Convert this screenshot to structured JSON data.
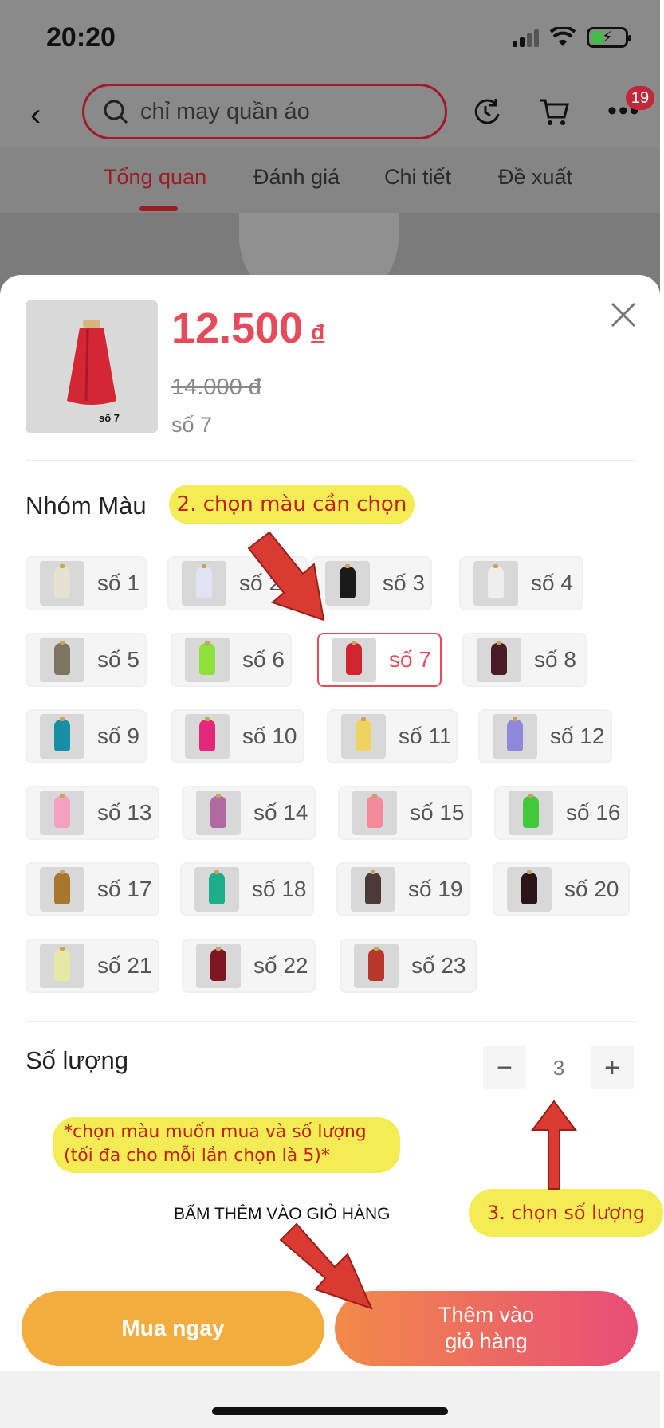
{
  "status_bar": {
    "time": "20:20"
  },
  "search": {
    "query": "chỉ may quần áo"
  },
  "cart_badge": "19",
  "tabs": [
    "Tổng quan",
    "Đánh giá",
    "Chi tiết",
    "Đề xuất"
  ],
  "product": {
    "thumb_caption": "số 7",
    "price": "12.500",
    "currency": "đ",
    "old_price": "14.000 đ",
    "selected_variant": "số 7"
  },
  "variant_group": {
    "title": "Nhóm Màu",
    "selected_index": 6,
    "options": [
      {
        "label": "số 1",
        "color": "#e6e2cf"
      },
      {
        "label": "số 2",
        "color": "#dfe3f2"
      },
      {
        "label": "số 3",
        "color": "#1a1a1a"
      },
      {
        "label": "số 4",
        "color": "#eeeeee"
      },
      {
        "label": "số 5",
        "color": "#7e7462"
      },
      {
        "label": "số 6",
        "color": "#8fe03a"
      },
      {
        "label": "số 7",
        "color": "#d22331"
      },
      {
        "label": "số 8",
        "color": "#4b1a27"
      },
      {
        "label": "số 9",
        "color": "#168fa6"
      },
      {
        "label": "số 10",
        "color": "#e3287a"
      },
      {
        "label": "số 11",
        "color": "#efd25f"
      },
      {
        "label": "số 12",
        "color": "#8f88d8"
      },
      {
        "label": "số 13",
        "color": "#f1a0bf"
      },
      {
        "label": "số 14",
        "color": "#b069a3"
      },
      {
        "label": "số 15",
        "color": "#f58a9b"
      },
      {
        "label": "số 16",
        "color": "#42c93b"
      },
      {
        "label": "số 17",
        "color": "#a8772d"
      },
      {
        "label": "số 18",
        "color": "#1fae8a"
      },
      {
        "label": "số 19",
        "color": "#4a3b38"
      },
      {
        "label": "số 20",
        "color": "#2a1418"
      },
      {
        "label": "số 21",
        "color": "#e6e8a6"
      },
      {
        "label": "số 22",
        "color": "#7d1622"
      },
      {
        "label": "số 23",
        "color": "#b9372a"
      }
    ]
  },
  "quantity": {
    "label": "Số lượng",
    "value": "3",
    "minus": "−",
    "plus": "+"
  },
  "buttons": {
    "buy_now": "Mua ngay",
    "add_to_cart_line1": "Thêm vào",
    "add_to_cart_line2": "giỏ hàng"
  },
  "annotations": {
    "step2": "2. chọn màu cần chọn",
    "hint_line1": "*chọn màu muốn mua và số lượng",
    "hint_line2": "(tối đa cho mỗi lần chọn là 5)*",
    "step3": "3. chọn số lượng",
    "press_cart": "BẤM THÊM VÀO GIỎ HÀNG"
  },
  "colors": {
    "accent": "#e54b5b",
    "buy": "#f2ad3e",
    "annotation_bg": "#f3ec55",
    "annotation_text": "#c3201a",
    "arrow": "#d93a31"
  }
}
